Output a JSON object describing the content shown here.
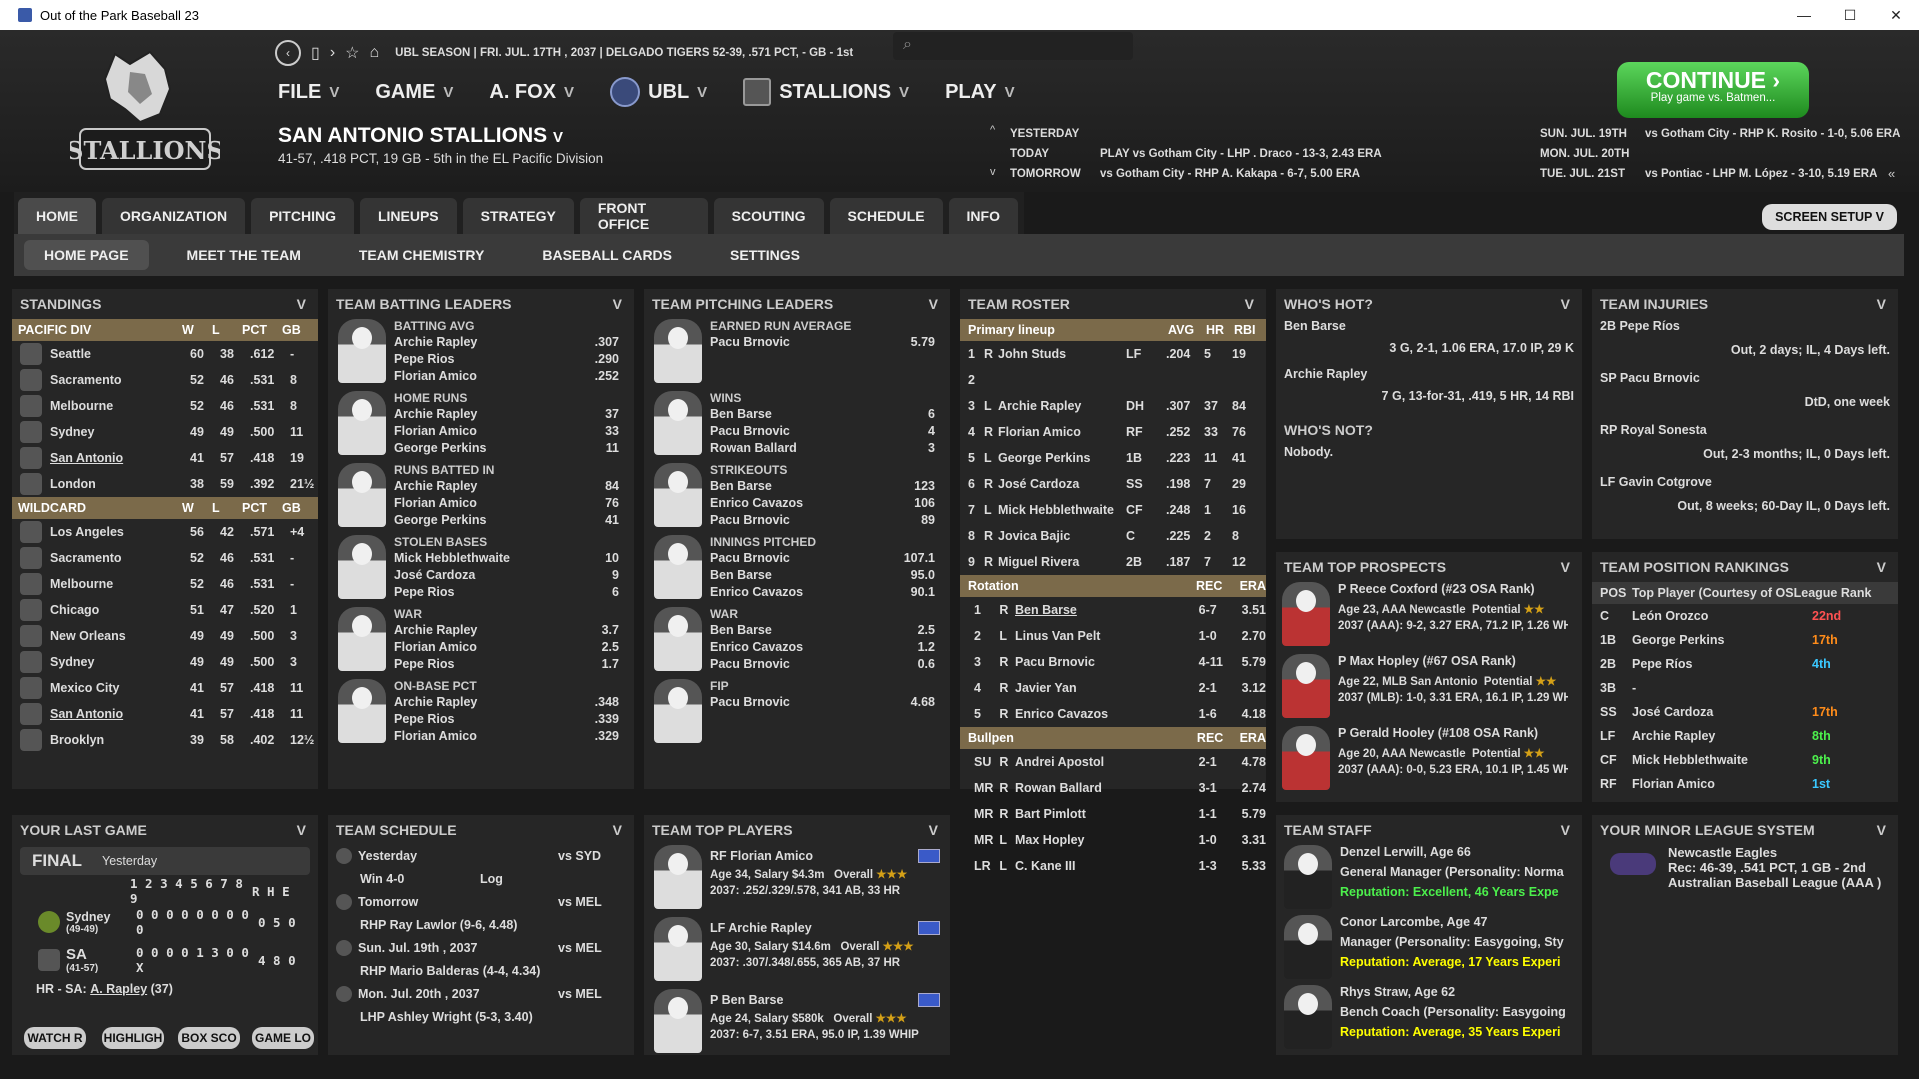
{
  "window": {
    "title": "Out of the Park Baseball 23",
    "min": "—",
    "max": "☐",
    "close": "✕"
  },
  "topbar": {
    "status": "UBL SEASON  |  FRI. JUL. 17TH , 2037  |  DELGADO TIGERS  52-39, .571 PCT, - GB - 1st",
    "search_icon": "search-icon"
  },
  "menu": [
    {
      "label": "FILE"
    },
    {
      "label": "GAME"
    },
    {
      "label": "A. FOX"
    },
    {
      "label": "UBL"
    },
    {
      "label": "STALLIONS"
    },
    {
      "label": "PLAY"
    }
  ],
  "team": {
    "name": "SAN ANTONIO STALLIONS",
    "record": "41-57, .418 PCT, 19 GB - 5th in the EL Pacific Division",
    "logo_text": "STALLIONS"
  },
  "schedule_strip": {
    "left": [
      {
        "label": "YESTERDAY",
        "text": ""
      },
      {
        "label": "TODAY",
        "text": "PLAY vs Gotham City - LHP . Draco - 13-3, 2.43 ERA"
      },
      {
        "label": "TOMORROW",
        "text": "vs Gotham City - RHP A. Kakapa - 6-7, 5.00 ERA"
      }
    ],
    "right": [
      {
        "label": "SUN. JUL. 19TH",
        "text": "vs Gotham City - RHP K. Rosito - 1-0, 5.06 ERA"
      },
      {
        "label": "MON. JUL. 20TH",
        "text": ""
      },
      {
        "label": "TUE. JUL. 21ST",
        "text": "vs Pontiac - LHP M. López - 3-10, 5.19 ERA"
      }
    ]
  },
  "continue": {
    "label": "CONTINUE",
    "sub": "Play game vs. Batmen..."
  },
  "tabs": [
    "HOME",
    "ORGANIZATION",
    "PITCHING",
    "LINEUPS",
    "STRATEGY",
    "FRONT OFFICE",
    "SCOUTING",
    "SCHEDULE",
    "INFO"
  ],
  "subtabs": [
    "HOME PAGE",
    "MEET THE TEAM",
    "TEAM CHEMISTRY",
    "BASEBALL CARDS",
    "SETTINGS"
  ],
  "screen_setup": "SCREEN SETUP",
  "standings": {
    "title": "STANDINGS",
    "div": "PACIFIC DIV",
    "cols": [
      "W",
      "L",
      "PCT",
      "GB"
    ],
    "rows": [
      [
        "Seattle",
        "60",
        "38",
        ".612",
        "-"
      ],
      [
        "Sacramento",
        "52",
        "46",
        ".531",
        "8"
      ],
      [
        "Melbourne",
        "52",
        "46",
        ".531",
        "8"
      ],
      [
        "Sydney",
        "49",
        "49",
        ".500",
        "11"
      ],
      [
        "San Antonio",
        "41",
        "57",
        ".418",
        "19"
      ],
      [
        "London",
        "38",
        "59",
        ".392",
        "21½"
      ]
    ],
    "wc": "WILDCARD",
    "wcrows": [
      [
        "Los Angeles",
        "56",
        "42",
        ".571",
        "+4"
      ],
      [
        "Sacramento",
        "52",
        "46",
        ".531",
        "-"
      ],
      [
        "Melbourne",
        "52",
        "46",
        ".531",
        "-"
      ],
      [
        "Chicago",
        "51",
        "47",
        ".520",
        "1"
      ],
      [
        "New Orleans",
        "49",
        "49",
        ".500",
        "3"
      ],
      [
        "Sydney",
        "49",
        "49",
        ".500",
        "3"
      ],
      [
        "Mexico City",
        "41",
        "57",
        ".418",
        "11"
      ],
      [
        "San Antonio",
        "41",
        "57",
        ".418",
        "11"
      ],
      [
        "Brooklyn",
        "39",
        "58",
        ".402",
        "12½"
      ]
    ]
  },
  "batting": {
    "title": "TEAM BATTING LEADERS",
    "groups": [
      {
        "h": "BATTING AVG",
        "r": [
          [
            "Archie Rapley",
            ".307"
          ],
          [
            "Pepe Rios",
            ".290"
          ],
          [
            "Florian Amico",
            ".252"
          ]
        ]
      },
      {
        "h": "HOME RUNS",
        "r": [
          [
            "Archie Rapley",
            "37"
          ],
          [
            "Florian Amico",
            "33"
          ],
          [
            "George Perkins",
            "11"
          ]
        ]
      },
      {
        "h": "RUNS BATTED IN",
        "r": [
          [
            "Archie Rapley",
            "84"
          ],
          [
            "Florian Amico",
            "76"
          ],
          [
            "George Perkins",
            "41"
          ]
        ]
      },
      {
        "h": "STOLEN BASES",
        "r": [
          [
            "Mick Hebblethwaite",
            "10"
          ],
          [
            "José Cardoza",
            "9"
          ],
          [
            "Pepe Rios",
            "6"
          ]
        ]
      },
      {
        "h": "WAR",
        "r": [
          [
            "Archie Rapley",
            "3.7"
          ],
          [
            "Florian Amico",
            "2.5"
          ],
          [
            "Pepe Rios",
            "1.7"
          ]
        ]
      },
      {
        "h": "ON-BASE PCT",
        "r": [
          [
            "Archie Rapley",
            ".348"
          ],
          [
            "Pepe Rios",
            ".339"
          ],
          [
            "Florian Amico",
            ".329"
          ]
        ]
      }
    ]
  },
  "pitching": {
    "title": "TEAM PITCHING LEADERS",
    "groups": [
      {
        "h": "EARNED RUN AVERAGE",
        "r": [
          [
            "Pacu Brnovic",
            "5.79"
          ]
        ]
      },
      {
        "h": "WINS",
        "r": [
          [
            "Ben Barse",
            "6"
          ],
          [
            "Pacu Brnovic",
            "4"
          ],
          [
            "Rowan Ballard",
            "3"
          ]
        ]
      },
      {
        "h": "STRIKEOUTS",
        "r": [
          [
            "Ben Barse",
            "123"
          ],
          [
            "Enrico Cavazos",
            "106"
          ],
          [
            "Pacu Brnovic",
            "89"
          ]
        ]
      },
      {
        "h": "INNINGS PITCHED",
        "r": [
          [
            "Pacu Brnovic",
            "107.1"
          ],
          [
            "Ben Barse",
            "95.0"
          ],
          [
            "Enrico Cavazos",
            "90.1"
          ]
        ]
      },
      {
        "h": "WAR",
        "r": [
          [
            "Ben Barse",
            "2.5"
          ],
          [
            "Enrico Cavazos",
            "1.2"
          ],
          [
            "Pacu Brnovic",
            "0.6"
          ]
        ]
      },
      {
        "h": "FIP",
        "r": [
          [
            "Pacu Brnovic",
            "4.68"
          ]
        ]
      }
    ]
  },
  "roster": {
    "title": "TEAM ROSTER",
    "lineup_h": "Primary lineup",
    "lineup_cols": [
      "AVG",
      "HR",
      "RBI"
    ],
    "lineup": [
      [
        "1",
        "R",
        "John Studs",
        "LF",
        ".204",
        "5",
        "19"
      ],
      [
        "2",
        "",
        "",
        "",
        "",
        "",
        ""
      ],
      [
        "3",
        "L",
        "Archie Rapley",
        "DH",
        ".307",
        "37",
        "84"
      ],
      [
        "4",
        "R",
        "Florian Amico",
        "RF",
        ".252",
        "33",
        "76"
      ],
      [
        "5",
        "L",
        "George Perkins",
        "1B",
        ".223",
        "11",
        "41"
      ],
      [
        "6",
        "R",
        "José Cardoza",
        "SS",
        ".198",
        "7",
        "29"
      ],
      [
        "7",
        "L",
        "Mick Hebblethwaite",
        "CF",
        ".248",
        "1",
        "16"
      ],
      [
        "8",
        "R",
        "Jovica Bajic",
        "C",
        ".225",
        "2",
        "8"
      ],
      [
        "9",
        "R",
        "Miguel Rivera",
        "2B",
        ".187",
        "7",
        "12"
      ]
    ],
    "rot_h": "Rotation",
    "rot_cols": [
      "REC",
      "ERA"
    ],
    "rot": [
      [
        "1",
        "R",
        "Ben Barse",
        "6-7",
        "3.51"
      ],
      [
        "2",
        "L",
        "Linus Van Pelt",
        "1-0",
        "2.70"
      ],
      [
        "3",
        "R",
        "Pacu Brnovic",
        "4-11",
        "5.79"
      ],
      [
        "4",
        "R",
        "Javier Yan",
        "2-1",
        "3.12"
      ],
      [
        "5",
        "R",
        "Enrico Cavazos",
        "1-6",
        "4.18"
      ]
    ],
    "pen_h": "Bullpen",
    "pen": [
      [
        "SU",
        "R",
        "Andrei Apostol",
        "2-1",
        "4.78"
      ],
      [
        "MR",
        "R",
        "Rowan Ballard",
        "3-1",
        "2.74"
      ],
      [
        "MR",
        "R",
        "Bart Pimlott",
        "1-1",
        "5.79"
      ],
      [
        "MR",
        "L",
        "Max Hopley",
        "1-0",
        "3.31"
      ],
      [
        "LR",
        "L",
        "C. Kane III",
        "1-3",
        "5.33"
      ]
    ]
  },
  "hot": {
    "title": "WHO'S HOT?",
    "items": [
      [
        "Ben Barse",
        "3 G, 2-1, 1.06 ERA, 17.0 IP, 29 K"
      ],
      [
        "Archie Rapley",
        "7 G, 13-for-31, .419, 5 HR, 14 RBI"
      ]
    ],
    "not_title": "WHO'S NOT?",
    "not_text": "Nobody."
  },
  "injuries": {
    "title": "TEAM INJURIES",
    "items": [
      [
        "2B Pepe Ríos",
        "Out, 2 days; IL, 4 Days left."
      ],
      [
        "SP Pacu Brnovic",
        "DtD, one week"
      ],
      [
        "RP Royal Sonesta",
        "Out, 2-3 months; IL, 0 Days left."
      ],
      [
        "LF Gavin Cotgrove",
        "Out, 8 weeks; 60-Day IL, 0 Days left."
      ]
    ]
  },
  "prospects": {
    "title": "TEAM TOP PROSPECTS",
    "items": [
      {
        "n": "P Reece Coxford (#23 OSA Rank)",
        "a": "Age 23, AAA Newcastle",
        "p": "Potential",
        "s": "2037 (AAA): 9-2, 3.27 ERA, 71.2 IP, 1.26 WH"
      },
      {
        "n": "P Max Hopley (#67 OSA Rank)",
        "a": "Age 22, MLB San Antonio",
        "p": "Potential",
        "s": "2037 (MLB): 1-0, 3.31 ERA, 16.1 IP, 1.29 WH"
      },
      {
        "n": "P Gerald Hooley (#108 OSA Rank)",
        "a": "Age 20, AAA Newcastle",
        "p": "Potential",
        "s": "2037 (AAA): 0-0, 5.23 ERA, 10.1 IP, 1.45 WH"
      }
    ]
  },
  "posrank": {
    "title": "TEAM POSITION RANKINGS",
    "h": [
      "POS",
      "Top Player (Courtesy of OSLeague Rank"
    ],
    "rows": [
      [
        "C",
        "León Orozco",
        "22nd",
        "red"
      ],
      [
        "1B",
        "George Perkins",
        "17th",
        "orange"
      ],
      [
        "2B",
        "Pepe Ríos",
        "4th",
        "cyan"
      ],
      [
        "3B",
        "-",
        "",
        ""
      ],
      [
        "SS",
        "José Cardoza",
        "17th",
        "orange"
      ],
      [
        "LF",
        "Archie Rapley",
        "8th",
        "green"
      ],
      [
        "CF",
        "Mick Hebblethwaite",
        "9th",
        "green"
      ],
      [
        "RF",
        "Florian Amico",
        "1st",
        "cyan"
      ]
    ]
  },
  "lastgame": {
    "title": "YOUR LAST GAME",
    "final": "FINAL",
    "when": "Yesterday",
    "innings": "1 2 3 4 5 6 7 8 9",
    "rhe": "R H E",
    "t1": {
      "n": "Sydney",
      "r": "(49-49)",
      "line": "0 0 0 0 0 0 0 0 0",
      "rhe": "0 5 0"
    },
    "t2": {
      "n": "SA",
      "r": "(41-57)",
      "line": "0 0 0 0 1 3 0 0 X",
      "rhe": "4 8 0"
    },
    "hr_label": "HR - SA:",
    "hr_player": "A. Rapley",
    "hr_count": "(37)",
    "buttons": [
      "WATCH R",
      "HIGHLIGH",
      "BOX SCO",
      "GAME LO"
    ]
  },
  "schedule": {
    "title": "TEAM SCHEDULE",
    "rows": [
      {
        "d": "Yesterday",
        "o": "vs SYD",
        "s": "Win 4-0",
        "l": "Log"
      },
      {
        "d": "Tomorrow",
        "o": "vs MEL",
        "s": "RHP Ray Lawlor (9-6, 4.48)",
        "l": ""
      },
      {
        "d": "Sun. Jul. 19th , 2037",
        "o": "vs MEL",
        "s": "RHP Mario Balderas (4-4, 4.34)",
        "l": ""
      },
      {
        "d": "Mon. Jul. 20th , 2037",
        "o": "vs MEL",
        "s": "LHP Ashley Wright (5-3, 3.40)",
        "l": ""
      }
    ]
  },
  "topplayers": {
    "title": "TEAM TOP PLAYERS",
    "items": [
      {
        "n": "RF Florian Amico",
        "a": "Age 34, Salary $4.3m",
        "o": "Overall",
        "s": "2037: .252/.329/.578, 341 AB, 33 HR"
      },
      {
        "n": "LF Archie Rapley",
        "a": "Age 30, Salary $14.6m",
        "o": "Overall",
        "s": "2037: .307/.348/.655, 365 AB, 37 HR"
      },
      {
        "n": "P Ben Barse",
        "a": "Age 24, Salary $580k",
        "o": "Overall",
        "s": "2037: 6-7, 3.51 ERA, 95.0 IP, 1.39 WHIP"
      }
    ]
  },
  "staff": {
    "title": "TEAM STAFF",
    "items": [
      {
        "n": "Denzel Lerwill, Age 66",
        "r": "General Manager (Personality: Norma",
        "rep": "Reputation: Excellent, 46 Years Expe",
        "c": "green"
      },
      {
        "n": "Conor Larcombe, Age 47",
        "r": "Manager (Personality: Easygoing, Sty",
        "rep": "Reputation: Average, 17 Years Experi",
        "c": "yellow"
      },
      {
        "n": "Rhys Straw, Age 62",
        "r": "Bench Coach (Personality: Easygoing",
        "rep": "Reputation: Average, 35 Years Experi",
        "c": "yellow"
      }
    ]
  },
  "minor": {
    "title": "YOUR MINOR LEAGUE SYSTEM",
    "team": "Newcastle Eagles",
    "rec": "Rec: 46-39, .541 PCT, 1 GB - 2nd",
    "league": "Australian Baseball League (AAA )"
  }
}
